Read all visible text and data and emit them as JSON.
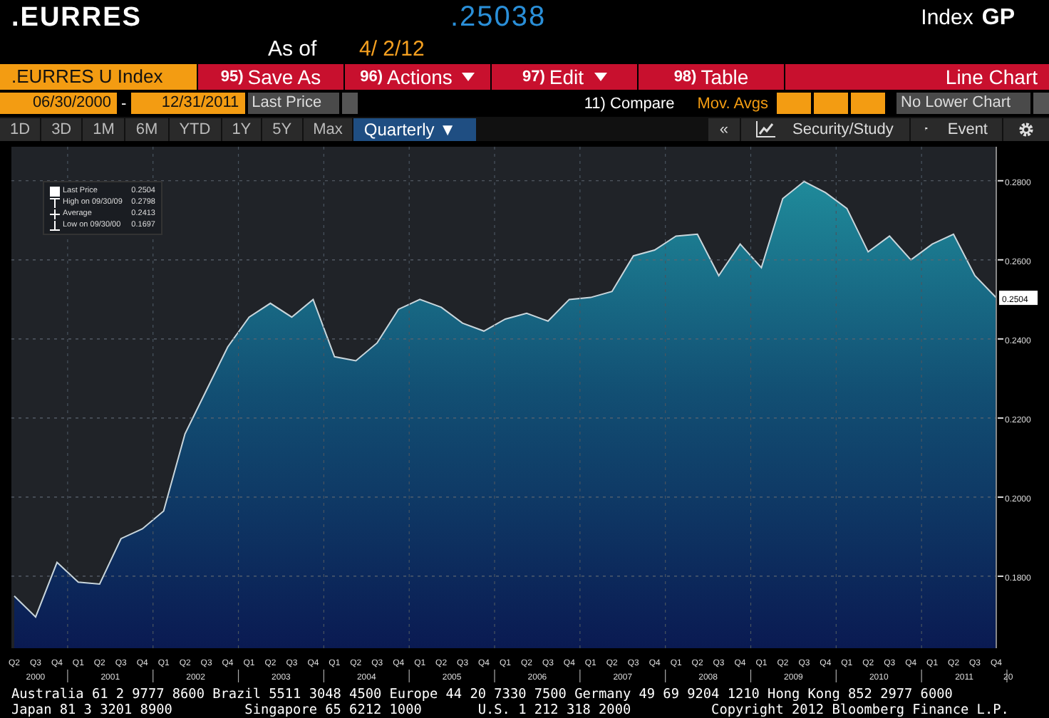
{
  "header": {
    "ticker": ".EURRES",
    "price": ".25038",
    "asof_label": "As of",
    "asof_date": "4/ 2/12",
    "type": "Index",
    "function": "GP"
  },
  "toolbar": {
    "security": ".EURRES U Index",
    "buttons": [
      {
        "number": "95)",
        "label": "Save As",
        "dropdown": false
      },
      {
        "number": "96)",
        "label": "Actions",
        "dropdown": true
      },
      {
        "number": "97)",
        "label": "Edit",
        "dropdown": true
      },
      {
        "number": "98)",
        "label": "Table",
        "dropdown": false
      }
    ],
    "chart_type": "Line Chart"
  },
  "range": {
    "start": "06/30/2000",
    "separator": "-",
    "end": "12/31/2011",
    "field": "Last Price",
    "compare": "11) Compare",
    "mov_avgs": "Mov. Avgs",
    "lower_chart": "No Lower Chart"
  },
  "periods": [
    {
      "label": "1D",
      "selected": false
    },
    {
      "label": "3D",
      "selected": false
    },
    {
      "label": "1M",
      "selected": false
    },
    {
      "label": "6M",
      "selected": false
    },
    {
      "label": "YTD",
      "selected": false
    },
    {
      "label": "1Y",
      "selected": false
    },
    {
      "label": "5Y",
      "selected": false
    },
    {
      "label": "Max",
      "selected": false
    },
    {
      "label": "Quarterly ▼",
      "selected": true
    }
  ],
  "tools": {
    "collapse": "«",
    "study": "Security/Study",
    "event": "Event"
  },
  "legend": [
    {
      "kind": "last",
      "value": "0.2504"
    },
    {
      "kind": "high",
      "label": "High on 09/30/09",
      "value": "0.2798"
    },
    {
      "kind": "average",
      "label": "Average",
      "value": "0.2413"
    },
    {
      "kind": "low",
      "label": "Low on 09/30/00",
      "value": "0.1697"
    }
  ],
  "chart": {
    "chart_data": {
      "type": "area",
      "categories": [
        "Q2",
        "Q3",
        "Q4",
        "Q1",
        "Q2",
        "Q3",
        "Q4",
        "Q1",
        "Q2",
        "Q3",
        "Q4",
        "Q1",
        "Q2",
        "Q3",
        "Q4",
        "Q1",
        "Q2",
        "Q3",
        "Q4",
        "Q1",
        "Q2",
        "Q3",
        "Q4",
        "Q1",
        "Q2",
        "Q3",
        "Q4",
        "Q1",
        "Q2",
        "Q3",
        "Q4",
        "Q1",
        "Q2",
        "Q3",
        "Q4",
        "Q1",
        "Q2",
        "Q3",
        "Q4",
        "Q1",
        "Q2",
        "Q3",
        "Q4",
        "Q1",
        "Q2",
        "Q3",
        "Q4"
      ],
      "series": [
        {
          "name": "Last Price",
          "color": "#1f8a9a",
          "values": [
            0.175,
            0.1697,
            0.1835,
            0.1785,
            0.178,
            0.1895,
            0.192,
            0.1965,
            0.216,
            0.227,
            0.238,
            0.2455,
            0.249,
            0.2455,
            0.25,
            0.2355,
            0.2345,
            0.239,
            0.2475,
            0.25,
            0.248,
            0.244,
            0.242,
            0.245,
            0.2465,
            0.2445,
            0.25,
            0.2505,
            0.252,
            0.261,
            0.2625,
            0.266,
            0.2665,
            0.256,
            0.264,
            0.258,
            0.2755,
            0.2798,
            0.277,
            0.273,
            0.262,
            0.266,
            0.26,
            0.264,
            0.2665,
            0.256,
            0.2504
          ]
        }
      ],
      "ylim": [
        0.1618,
        0.2886
      ],
      "grid": true,
      "yticks": [
        {
          "value": 0.18,
          "label": "0.1800"
        },
        {
          "value": 0.2,
          "label": "0.2000"
        },
        {
          "value": 0.22,
          "label": "0.2200"
        },
        {
          "value": 0.24,
          "label": "0.2400"
        },
        {
          "value": 0.26,
          "label": "0.2600"
        },
        {
          "value": 0.28,
          "label": "0.2800"
        }
      ],
      "orientation": "vertical"
    },
    "year_labels": [
      "2000",
      "2001",
      "2002",
      "2003",
      "2004",
      "2005",
      "2006",
      "2007",
      "2008",
      "2009",
      "2010",
      "2011",
      "20"
    ],
    "last_price_tag": "0.2504"
  },
  "footer": [
    "Australia 61 2 9777 8600 Brazil 5511 3048 4500 Europe 44 20 7330 7500 Germany 49 69 9204 1210 Hong Kong 852 2977 6000",
    "Japan 81 3 3201 8900         Singapore 65 6212 1000       U.S. 1 212 318 2000          Copyright 2012 Bloomberg Finance L.P."
  ]
}
